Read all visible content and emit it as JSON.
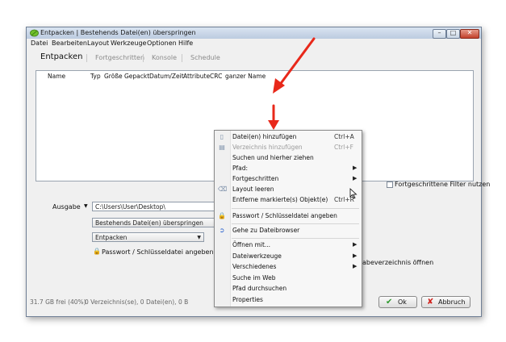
{
  "window": {
    "title": "Entpacken | Bestehends Datei(en) überspringen",
    "controls": {
      "minimize": "–",
      "maximize": "□",
      "close": "✕"
    }
  },
  "menubar": [
    "Datei",
    "Bearbeiten",
    "Layout",
    "Werkzeuge",
    "Optionen",
    "Hilfe"
  ],
  "tabs": [
    "Entpacken",
    "Fortgeschritten",
    "Konsole",
    "Schedule"
  ],
  "file_list": {
    "columns": [
      "Name",
      "Typ",
      "Größe",
      "Gepackt",
      "Datum/Zeit",
      "Attribute",
      "CRC",
      "ganzer Name"
    ]
  },
  "advanced_filter_label": "Fortgeschrittene Filter nutzen",
  "output": {
    "label": "Ausgabe",
    "path": "C:\\Users\\User\\Desktop\\",
    "overwrite_mode": "Bestehends Datei(en) überspringen",
    "action": "Entpacken",
    "password_label": "Passwort / Schlüsseldatei angeben",
    "open_folder_partial": "abeverzeichnis öffnen"
  },
  "status_bar": {
    "free_space": "31.7 GB frei (40%)",
    "counts": "0 Verzeichnis(se), 0 Datei(en), 0 B"
  },
  "buttons": {
    "ok": "Ok",
    "cancel": "Abbruch"
  },
  "context_menu": [
    {
      "label": "Datei(en) hinzufügen",
      "shortcut": "Ctrl+A",
      "disabled": false,
      "icon": "file-add-icon"
    },
    {
      "label": "Verzeichnis hinzufügen",
      "shortcut": "Ctrl+F",
      "disabled": true,
      "icon": "folder-add-icon"
    },
    {
      "label": "Suchen und hierher ziehen",
      "shortcut": "",
      "disabled": false
    },
    {
      "label": "Pfad:",
      "submenu": true
    },
    {
      "label": "Fortgeschritten",
      "submenu": true
    },
    {
      "label": "Layout leeren",
      "icon": "eraser-icon"
    },
    {
      "label": "Entferne markierte(s) Objekt(e)",
      "shortcut": "Ctrl+R"
    },
    {
      "label": "Passwort / Schlüsseldatei angeben",
      "icon": "lock-icon"
    },
    {
      "label": "Gehe zu Dateibrowser",
      "icon": "go-arrow-icon"
    },
    {
      "label": "Öffnen mit...",
      "submenu": true
    },
    {
      "label": "Dateiwerkzeuge",
      "submenu": true
    },
    {
      "label": "Verschiedenes",
      "submenu": true
    },
    {
      "label": "Suche im Web"
    },
    {
      "label": "Pfad durchsuchen"
    },
    {
      "label": "Properties"
    }
  ],
  "colors": {
    "annotation_arrow": "#e8281a",
    "ok_check": "#2e9a2e",
    "cancel_x": "#d0201a"
  }
}
